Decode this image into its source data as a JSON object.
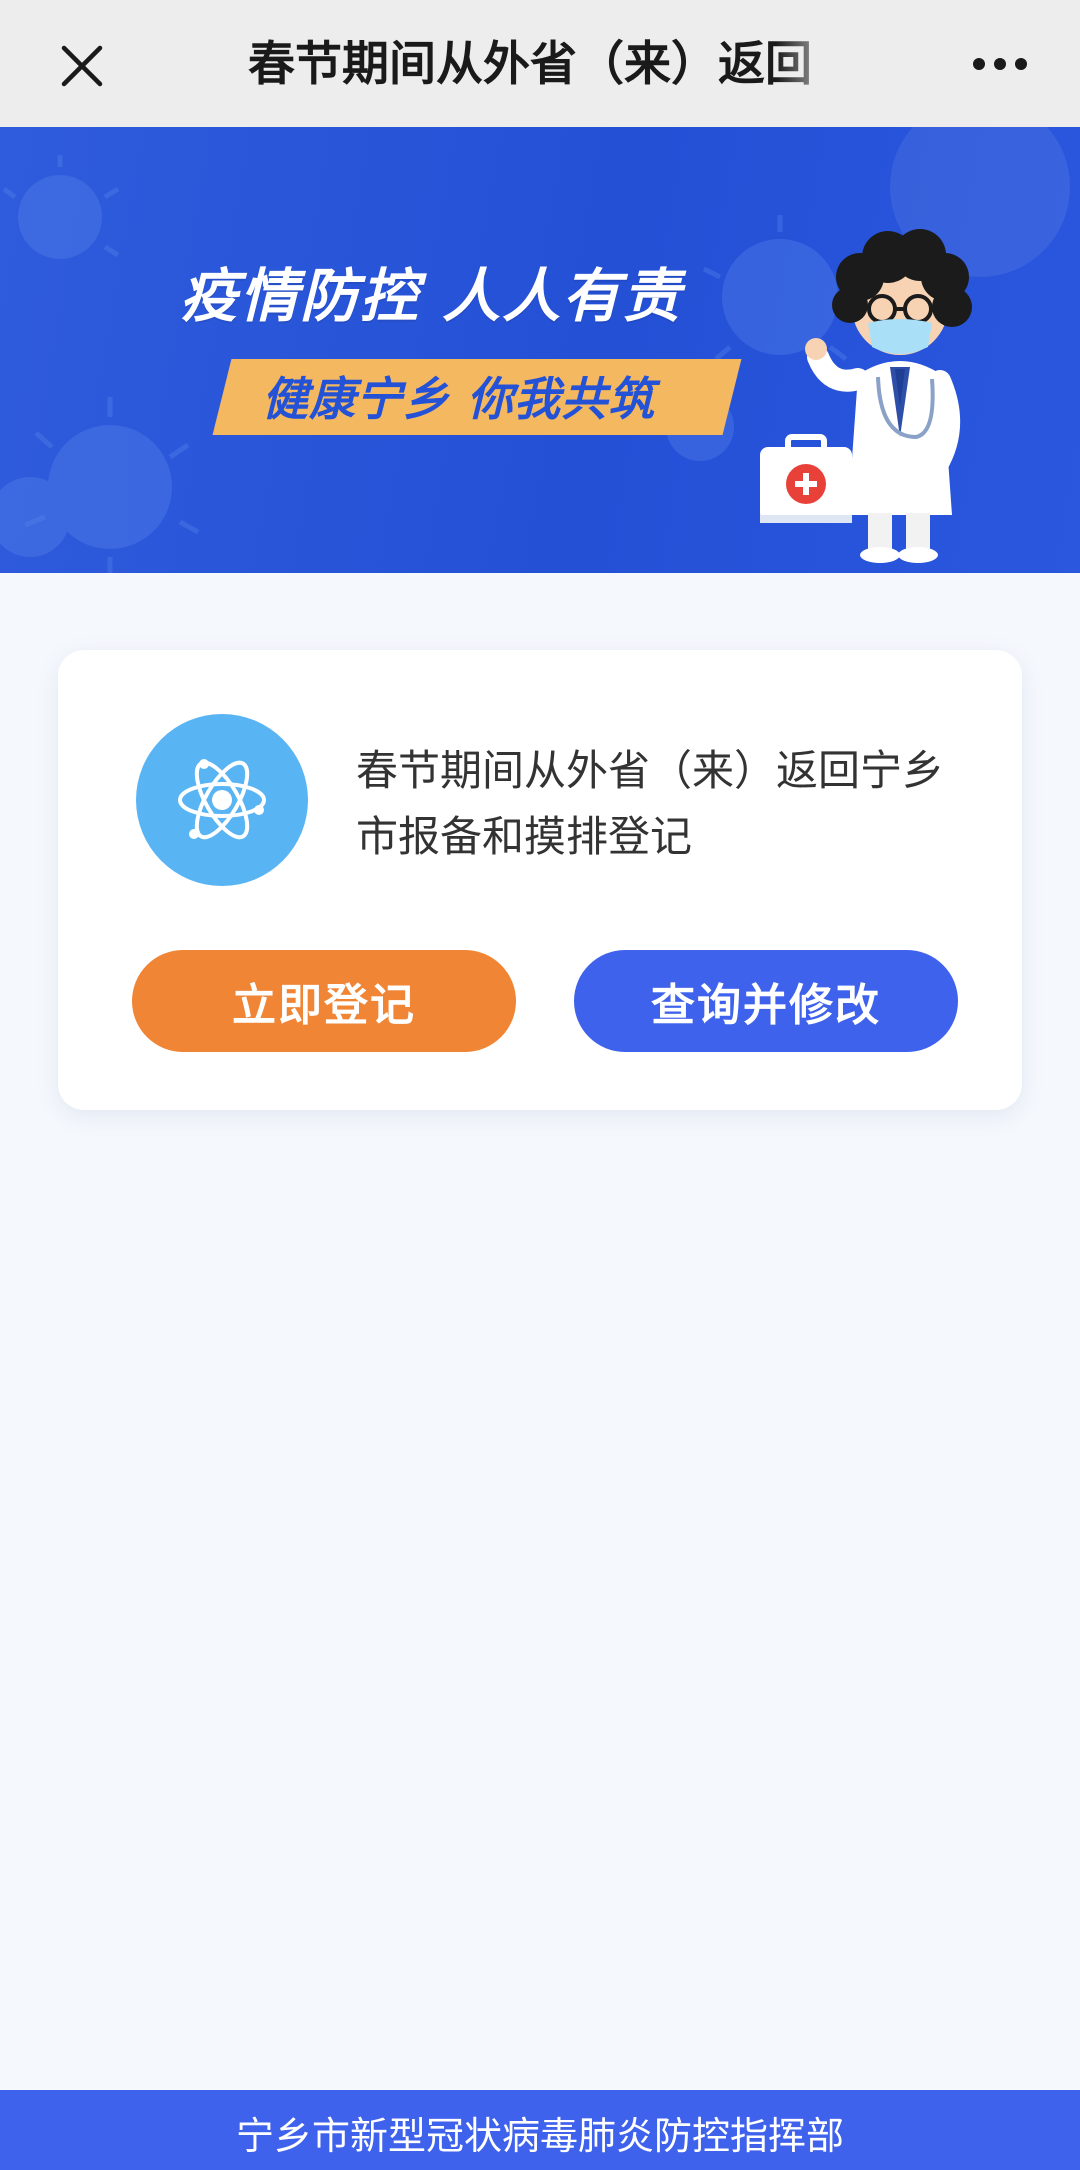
{
  "topbar": {
    "title": "春节期间从外省（来）返回",
    "close_icon": "close-icon",
    "more_icon": "more-dots-icon"
  },
  "banner": {
    "slogan_main": "疫情防控  人人有责",
    "slogan_sub": "健康宁乡  你我共筑",
    "colors": {
      "background": "#2450d6",
      "accent": "#f3b860"
    }
  },
  "card": {
    "title": "春节期间从外省（来）返回宁乡市报备和摸排登记",
    "icon": "atom-icon",
    "register_label": "立即登记",
    "query_label": "查询并修改",
    "colors": {
      "register": "#ef8535",
      "query": "#3f62ed",
      "logo": "#59b4f4"
    }
  },
  "footer": {
    "text": "宁乡市新型冠状病毒肺炎防控指挥部"
  }
}
